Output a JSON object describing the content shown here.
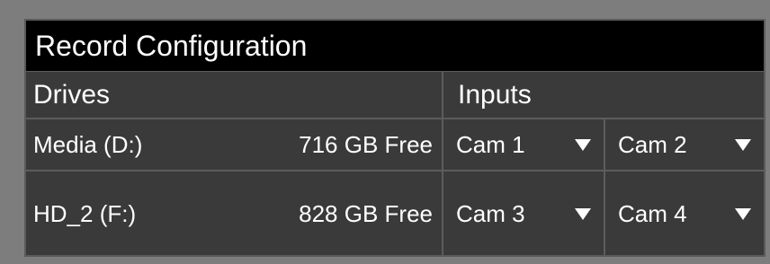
{
  "title": "Record Configuration",
  "headers": {
    "drives": "Drives",
    "inputs": "Inputs"
  },
  "drives": [
    {
      "name": "Media (D:)",
      "free": "716 GB Free",
      "inputs": [
        {
          "label": "Cam 1",
          "icon": "dropdown-arrow-icon"
        },
        {
          "label": "Cam 2",
          "icon": "dropdown-arrow-icon"
        }
      ]
    },
    {
      "name": "HD_2 (F:)",
      "free": "828 GB Free",
      "inputs": [
        {
          "label": "Cam 3",
          "icon": "dropdown-arrow-icon"
        },
        {
          "label": "Cam 4",
          "icon": "dropdown-arrow-icon"
        }
      ]
    }
  ],
  "colors": {
    "background": "#7d7d7d",
    "panel": "#3a3a3a",
    "title_bar": "#000000",
    "grid_lines": "#5c5c5c",
    "text": "#ffffff"
  }
}
